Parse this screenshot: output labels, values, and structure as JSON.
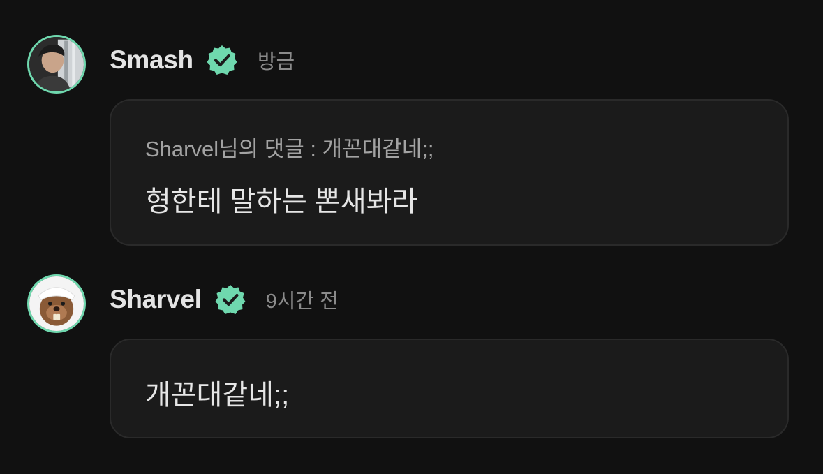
{
  "comments": [
    {
      "username": "Smash",
      "verified": true,
      "time": "방금",
      "reply_to": "Sharvel님의 댓글 : 개꼰대같네;;",
      "text": "형한테 말하는 뽄새봐라",
      "avatar_icon": "user-photo-icon"
    },
    {
      "username": "Sharvel",
      "verified": true,
      "time": "9시간 전",
      "text": "개꼰대같네;;",
      "avatar_icon": "beaver-photo-icon"
    }
  ],
  "colors": {
    "background": "#111111",
    "bubble": "#1b1b1b",
    "accent": "#6fd8ae",
    "username": "#e4e4e4",
    "muted": "#8b8b8b"
  }
}
